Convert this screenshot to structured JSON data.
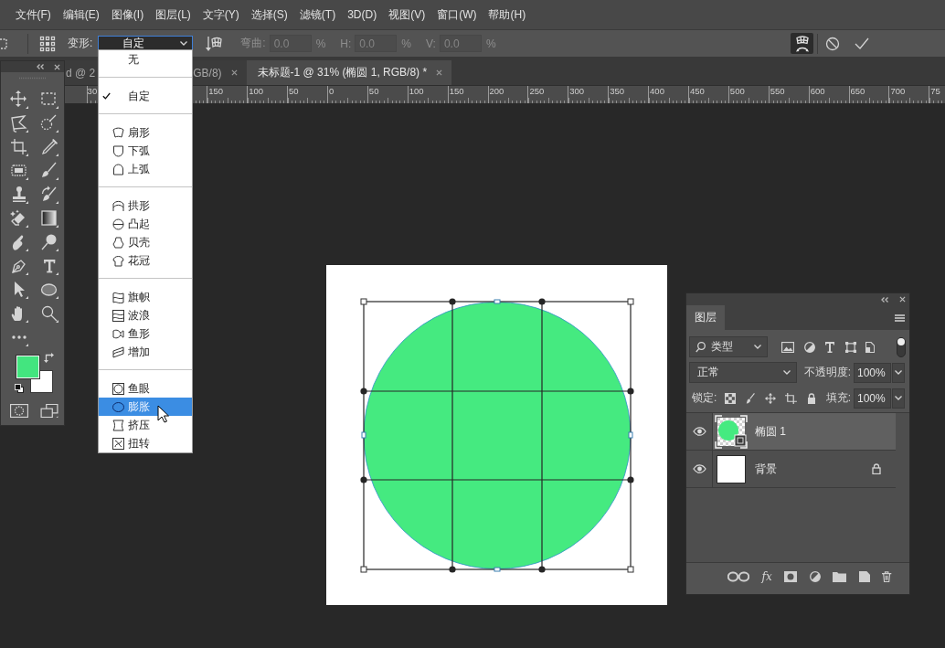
{
  "menu_bar": {
    "items": [
      "文件(F)",
      "编辑(E)",
      "图像(I)",
      "图层(L)",
      "文字(Y)",
      "选择(S)",
      "滤镜(T)",
      "3D(D)",
      "视图(V)",
      "窗口(W)",
      "帮助(H)"
    ]
  },
  "options_bar": {
    "warp_style": {
      "label": "变形:",
      "value": "自定",
      "expanded": true
    },
    "fields": [
      {
        "label": "弯曲:",
        "value": "0.0",
        "unit": "%",
        "disabled": true
      },
      {
        "label": "H:",
        "value": "0.0",
        "unit": "%",
        "disabled": true
      },
      {
        "label": "V:",
        "value": "0.0",
        "unit": "%",
        "disabled": true
      }
    ],
    "warp_mode": {
      "on": true
    }
  },
  "warp_menu": {
    "groups": [
      {
        "items": [
          {
            "label": "无",
            "checked": false,
            "selected": false
          }
        ]
      },
      {
        "items": [
          {
            "label": "自定",
            "checked": true,
            "selected": false
          }
        ]
      },
      {
        "items": [
          {
            "label": "扇形",
            "checked": false,
            "selected": false
          },
          {
            "label": "下弧",
            "checked": false,
            "selected": false
          },
          {
            "label": "上弧",
            "checked": false,
            "selected": false
          }
        ]
      },
      {
        "items": [
          {
            "label": "拱形",
            "checked": false,
            "selected": false
          },
          {
            "label": "凸起",
            "checked": false,
            "selected": false
          },
          {
            "label": "贝壳",
            "checked": false,
            "selected": false
          },
          {
            "label": "花冠",
            "checked": false,
            "selected": false
          }
        ]
      },
      {
        "items": [
          {
            "label": "旗帜",
            "checked": false,
            "selected": false
          },
          {
            "label": "波浪",
            "checked": false,
            "selected": false
          },
          {
            "label": "鱼形",
            "checked": false,
            "selected": false
          },
          {
            "label": "增加",
            "checked": false,
            "selected": false
          }
        ]
      },
      {
        "items": [
          {
            "label": "鱼眼",
            "checked": false,
            "selected": false
          },
          {
            "label": "膨胀",
            "checked": false,
            "selected": true
          },
          {
            "label": "挤压",
            "checked": false,
            "selected": false
          },
          {
            "label": "扭转",
            "checked": false,
            "selected": false
          }
        ]
      }
    ]
  },
  "document_tabs": [
    {
      "title_parts": [
        "d @ 2",
        "GB/8)"
      ],
      "selected": false
    },
    {
      "title_parts": [
        "未标题-1 @ 31% (椭圆 1, RGB/8) *"
      ],
      "selected": true
    }
  ],
  "ruler": {
    "labels": [
      "30",
      "150",
      "100",
      "50",
      "0",
      "50",
      "100",
      "150",
      "200",
      "250",
      "300",
      "350",
      "400",
      "450",
      "500",
      "550",
      "600",
      "650",
      "700",
      "75"
    ]
  },
  "layers_panel": {
    "tabs": [
      {
        "label": "图层",
        "selected": true
      }
    ],
    "filter": {
      "value": "类型",
      "on": true
    },
    "blend_mode": "正常",
    "opacity": {
      "label": "不透明度:",
      "value": "100%"
    },
    "lock_label": "锁定:",
    "fill": {
      "label": "填充:",
      "value": "100%"
    },
    "layers": [
      {
        "name": "椭圆 1",
        "kind": "shape",
        "visible": true,
        "selected": true,
        "locked": false
      },
      {
        "name": "背景",
        "kind": "background",
        "visible": true,
        "selected": false,
        "locked": true
      }
    ],
    "style_button": "fx"
  }
}
